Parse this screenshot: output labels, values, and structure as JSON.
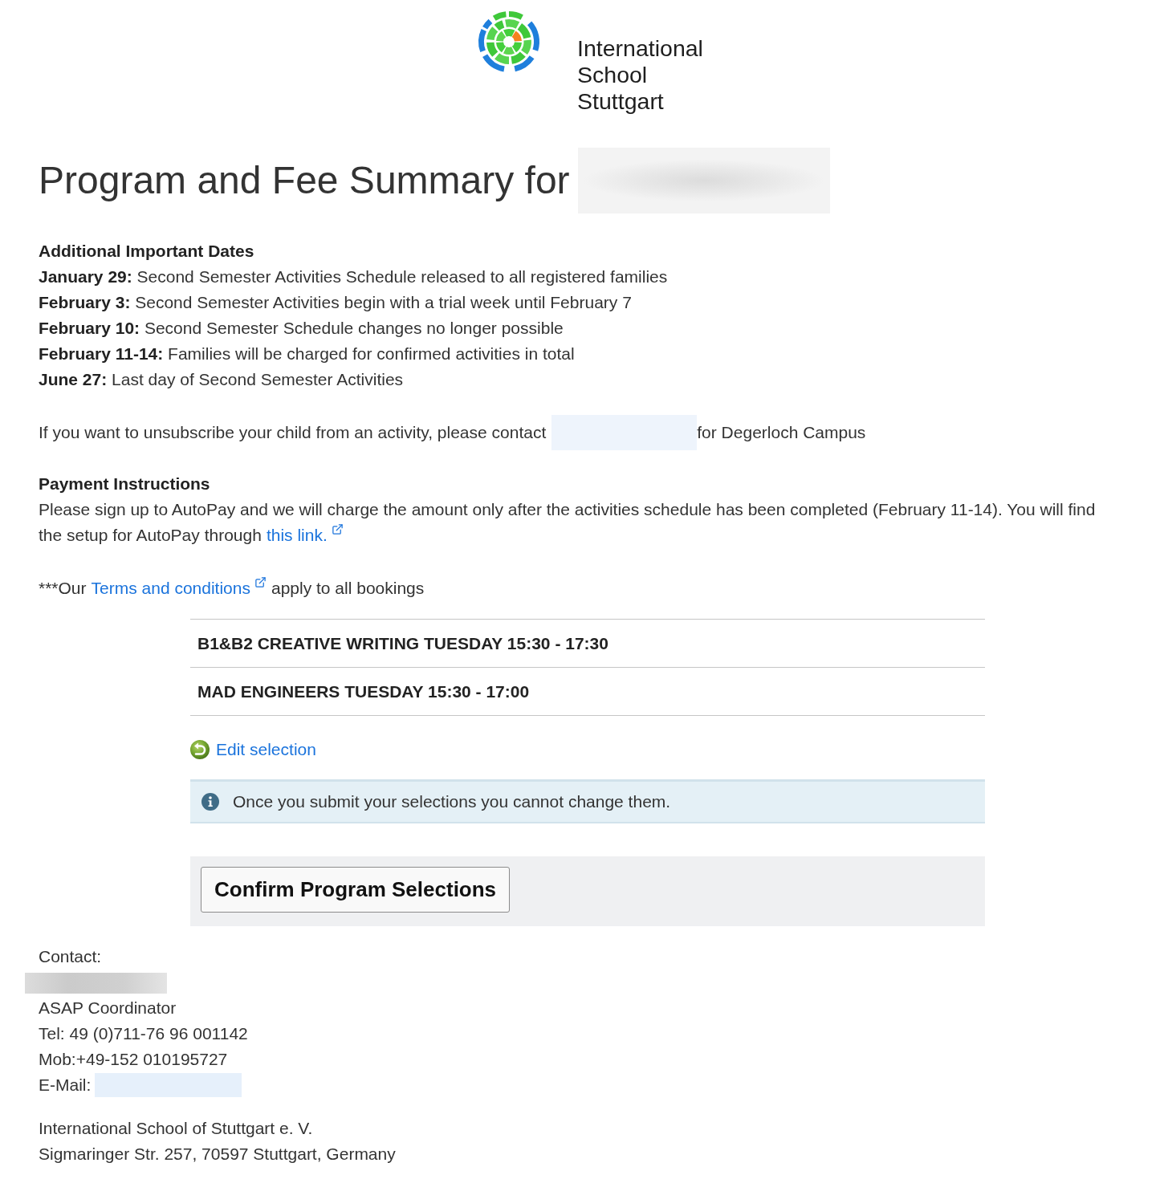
{
  "logo": {
    "name": "International School Stuttgart"
  },
  "title": {
    "text": "Program and Fee Summary for",
    "name_redacted": true
  },
  "important_dates": {
    "heading": "Additional Important Dates",
    "items": [
      "**January 29:** Second Semester Activities Schedule released to all registered families",
      "**February 3:** Second Semester Activities begin with a trial week until February 7",
      "**February 10:** Second Semester Schedule changes no longer possible",
      "**February 11-14:** Families will be charged for confirmed activities in total",
      "**June 27:** Last day of Second Semester Activities"
    ]
  },
  "unsubscribe": {
    "lead": "If you want to unsubscribe your child from an activity, please contact",
    "contact_redacted": true,
    "tail": "for Degerloch Campus"
  },
  "payment": {
    "heading": "Payment Instructions",
    "text": "Please sign up to AutoPay and we will charge the amount only after the activities schedule has been completed (February 11-14). You will find the setup for AutoPay through",
    "link": "this link."
  },
  "terms": {
    "lead": "***Our",
    "link": "Terms and conditions",
    "tail": "apply to all bookings"
  },
  "activities": [
    "B1&B2 CREATIVE WRITING TUESDAY 15:30 - 17:30",
    "MAD ENGINEERS TUESDAY 15:30 - 17:00"
  ],
  "edit_link": "Edit selection",
  "notice": "Once you submit your selections you cannot change them.",
  "confirm_button": "Confirm Program Selections",
  "contact": {
    "label": "Contact:",
    "name_redacted": true,
    "lines": [
      "ASAP Coordinator",
      "Tel: 49 (0)711-76 96 001142",
      "Mob:+49-152 010195727"
    ],
    "email_label": "E-Mail:",
    "email_redacted": true
  },
  "address": [
    "International School of Stuttgart e. V.",
    "Sigmaringer Str. 257, 70597 Stuttgart, Germany"
  ]
}
